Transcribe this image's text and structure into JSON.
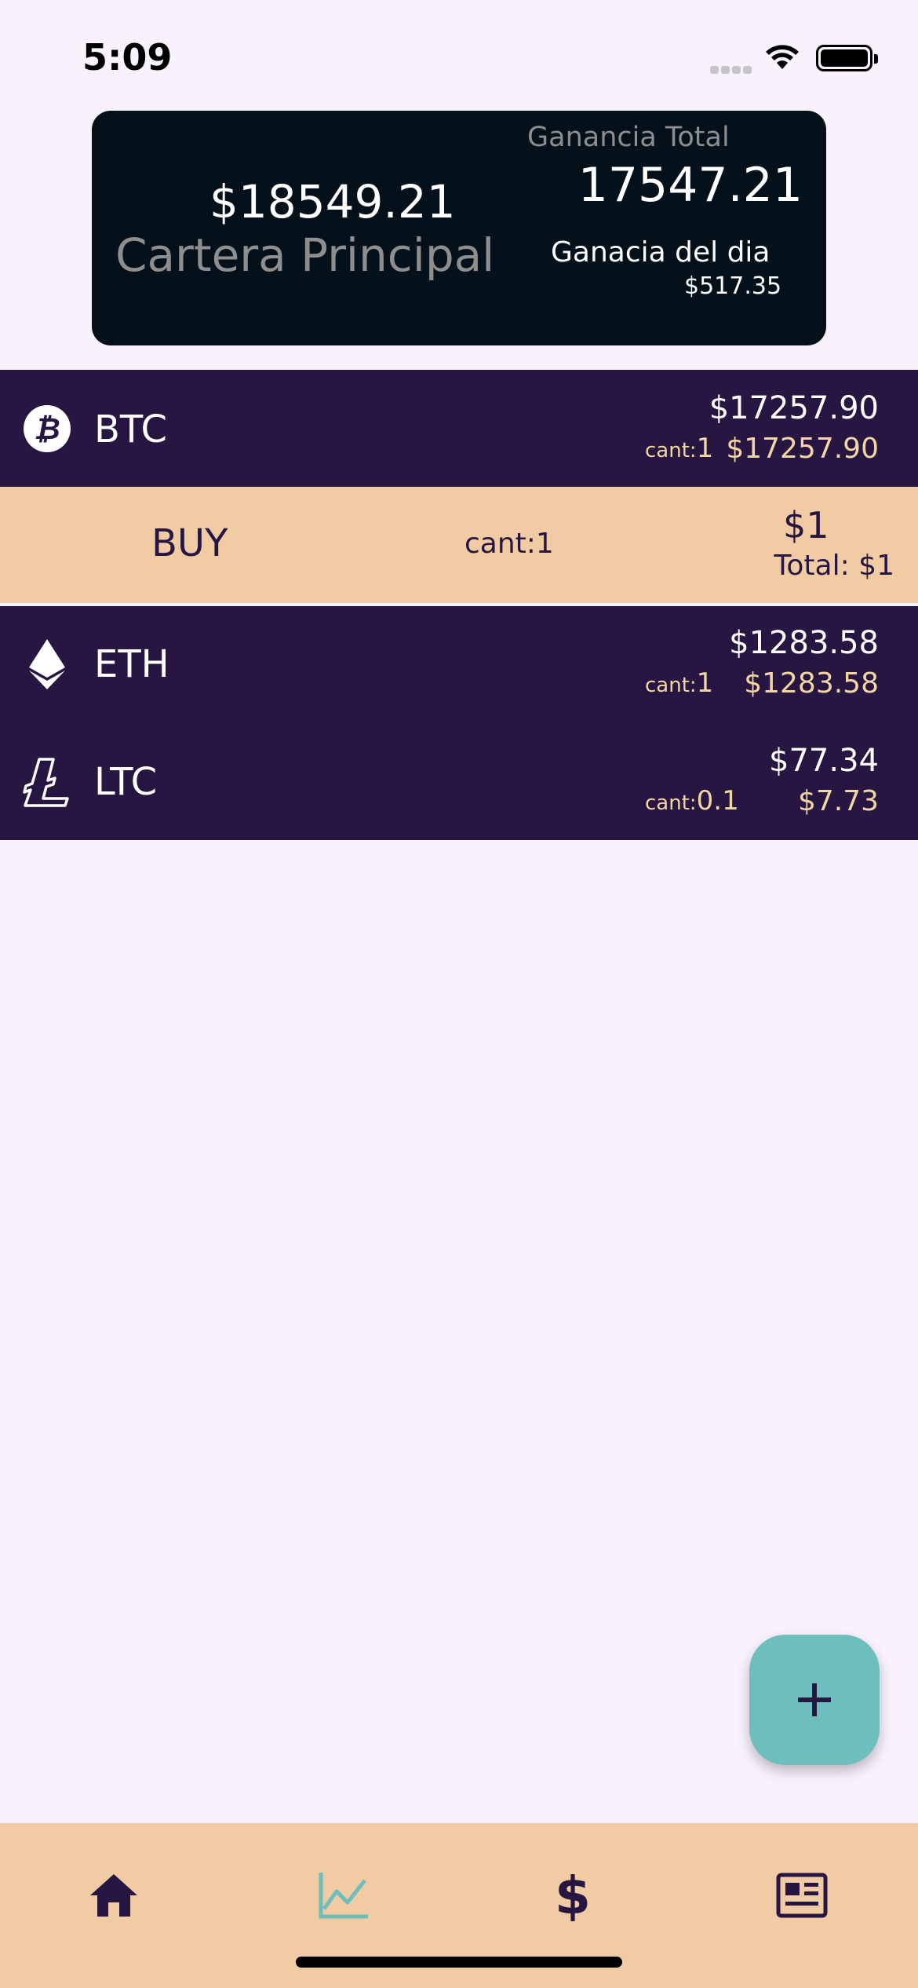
{
  "status_bar": {
    "time": "5:09"
  },
  "summary": {
    "balance": "$18549.21",
    "portfolio_name": "Cartera Principal",
    "total_gain_label": "Ganancia Total",
    "total_gain_value": "17547.21",
    "day_gain_label": "Ganacia del dia",
    "day_gain_value": "$517.35"
  },
  "coins": [
    {
      "symbol": "BTC",
      "icon": "bitcoin-icon",
      "price": "$17257.90",
      "qty_label": "cant:",
      "qty": "1",
      "holding": "$17257.90"
    },
    {
      "symbol": "ETH",
      "icon": "ethereum-icon",
      "price": "$1283.58",
      "qty_label": "cant:",
      "qty": "1",
      "holding": "$1283.58"
    },
    {
      "symbol": "LTC",
      "icon": "litecoin-icon",
      "price": "$77.34",
      "qty_label": "cant:",
      "qty": "0.1",
      "holding": "$7.73"
    }
  ],
  "transaction": {
    "type": "BUY",
    "qty": "cant:1",
    "price": "$1",
    "total": "Total: $1"
  },
  "fab": {
    "icon": "plus-icon"
  },
  "nav": [
    {
      "name": "home",
      "icon": "home-icon",
      "active": false
    },
    {
      "name": "chart",
      "icon": "chart-line-icon",
      "active": true
    },
    {
      "name": "dollar",
      "icon": "dollar-icon",
      "active": false
    },
    {
      "name": "news",
      "icon": "newspaper-icon",
      "active": false
    }
  ],
  "colors": {
    "background": "#f8f2fd",
    "card": "#04101a",
    "row_dark": "#261641",
    "accent_peach": "#f1cba3",
    "accent_teal": "#6fbebe",
    "qty_text": "#f4d6a4"
  }
}
